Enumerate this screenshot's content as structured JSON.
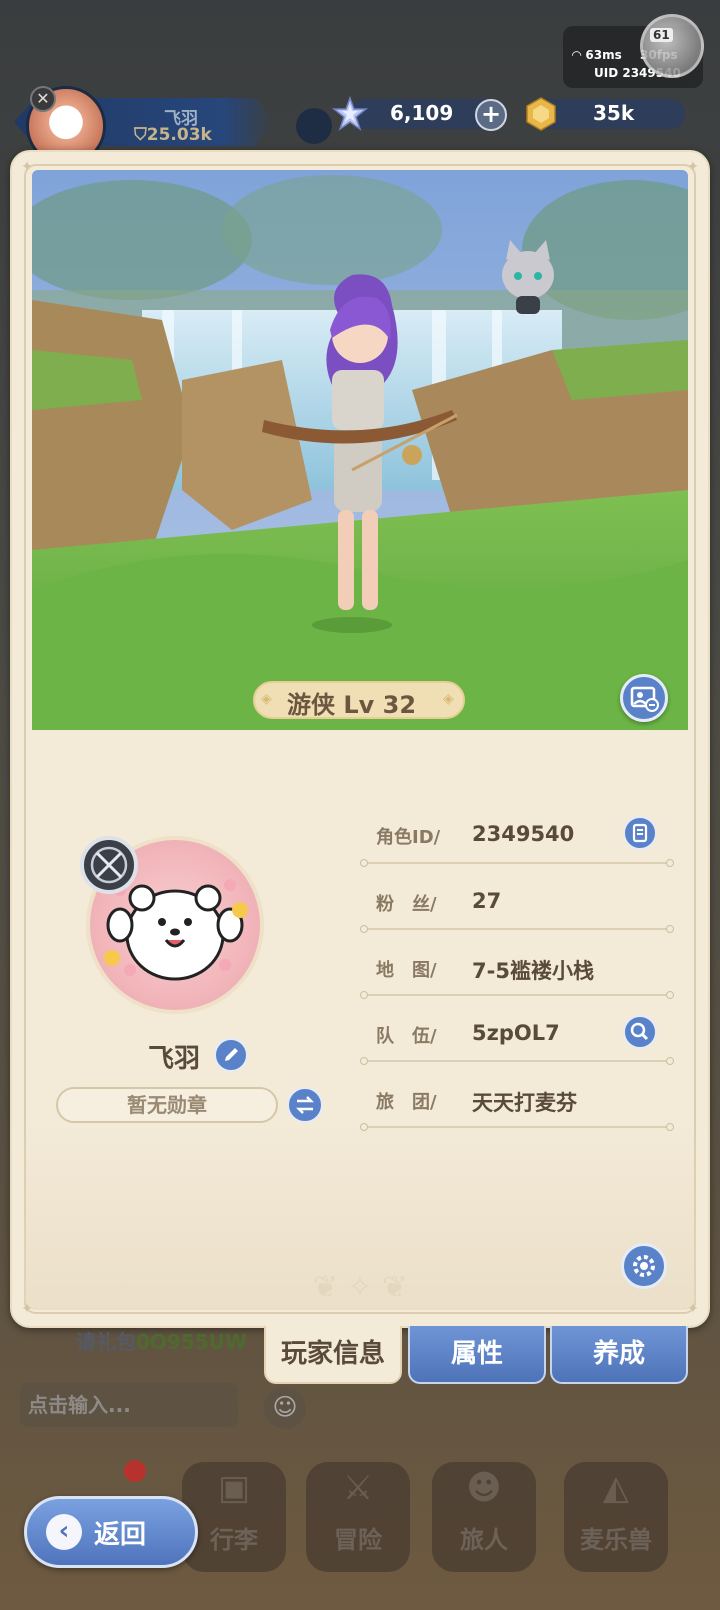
{
  "status": {
    "ping": "63ms",
    "fps": "30fps",
    "uid": "UID 2349540",
    "badge_number": "61"
  },
  "top_profile": {
    "name": "飞羽",
    "power": "25.03k"
  },
  "currencies": {
    "stars": "6,109",
    "coins": "35k"
  },
  "character": {
    "class_level": "游侠 Lv 32"
  },
  "player": {
    "name": "飞羽",
    "medal": "暂无勋章"
  },
  "info": {
    "rows": [
      {
        "label": "角色ID/",
        "value": "2349540"
      },
      {
        "label": "粉　丝/",
        "value": "27"
      },
      {
        "label": "地　图/",
        "value": "7-5褴褛小栈"
      },
      {
        "label": "队　伍/",
        "value": "5zpOL7"
      },
      {
        "label": "旅　团/",
        "value": "天天打麦芬"
      }
    ]
  },
  "tabs": {
    "player_info": "玩家信息",
    "attributes": "属性",
    "growth": "养成"
  },
  "background_ui": {
    "gift_prefix": "请礼包",
    "gift_code": "0O955UW",
    "chat_placeholder": "点击输入...",
    "nav": [
      "行李",
      "冒险",
      "旅人",
      "麦乐兽"
    ]
  },
  "back_button": {
    "label": "返回"
  },
  "colors": {
    "panel": "#f3ead8",
    "accent_blue": "#5a82c8",
    "class_pill": "#f0dfb4"
  }
}
